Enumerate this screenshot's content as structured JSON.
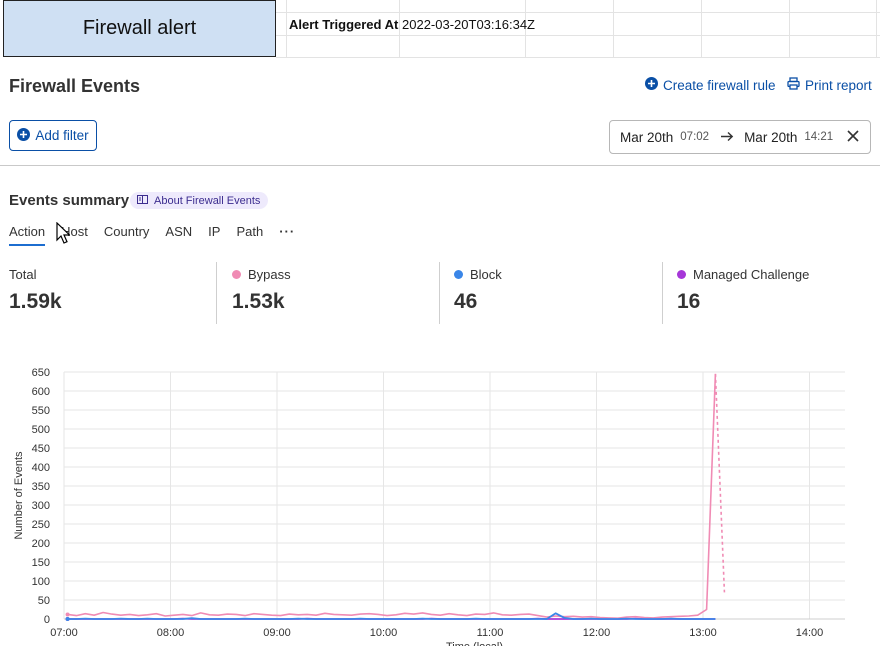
{
  "sheet": {
    "title_cell": "Firewall alert",
    "label_cell": "Alert Triggered At",
    "value_cell": "2022-03-20T03:16:34Z"
  },
  "header": {
    "title": "Firewall Events",
    "create_rule": "Create firewall rule",
    "print_report": "Print report"
  },
  "filters": {
    "add_filter": "Add filter",
    "start_date": "Mar 20th",
    "start_time": "07:02",
    "end_date": "Mar 20th",
    "end_time": "14:21"
  },
  "summary": {
    "title": "Events summary",
    "about_link": "About Firewall Events",
    "tabs": [
      "Action",
      "Host",
      "Country",
      "ASN",
      "IP",
      "Path"
    ],
    "more": "···",
    "stats": [
      {
        "label": "Total",
        "value": "1.59k",
        "color": ""
      },
      {
        "label": "Bypass",
        "value": "1.53k",
        "color": "#f08bb4"
      },
      {
        "label": "Block",
        "value": "46",
        "color": "#3a86e8"
      },
      {
        "label": "Managed Challenge",
        "value": "16",
        "color": "#a637d8"
      }
    ]
  },
  "colors": {
    "accent": "#0a4fa6",
    "bypass": "#f08bb4",
    "block": "#3a86e8",
    "managed_challenge": "#a637d8"
  },
  "chart_data": {
    "type": "line",
    "ylabel": "Number of Events",
    "xlabel": "Time (local)",
    "ylim": [
      0,
      650
    ],
    "yticks": [
      0,
      50,
      100,
      150,
      200,
      250,
      300,
      350,
      400,
      450,
      500,
      550,
      600,
      650
    ],
    "xticks": [
      "07:00",
      "08:00",
      "09:00",
      "10:00",
      "11:00",
      "12:00",
      "13:00",
      "14:00"
    ],
    "grid": true,
    "x_start": "07:02",
    "x_step_minutes": 5,
    "series": [
      {
        "name": "Bypass",
        "color": "#f08bb4",
        "values": [
          12,
          9,
          14,
          10,
          17,
          13,
          10,
          12,
          9,
          11,
          14,
          8,
          10,
          12,
          9,
          16,
          11,
          10,
          13,
          12,
          9,
          14,
          12,
          10,
          9,
          13,
          11,
          12,
          10,
          15,
          12,
          11,
          10,
          13,
          14,
          12,
          9,
          11,
          15,
          13,
          16,
          12,
          10,
          14,
          11,
          9,
          13,
          12,
          16,
          11,
          10,
          12,
          13,
          9,
          5,
          8,
          6,
          7,
          5,
          6,
          4,
          3,
          2,
          5,
          6,
          4,
          3,
          5,
          6,
          7,
          8,
          10,
          25,
          645
        ],
        "projected": [
          645,
          70
        ]
      },
      {
        "name": "Block",
        "color": "#3a86e8",
        "values": [
          0,
          0,
          1,
          0,
          0,
          0,
          1,
          0,
          0,
          1,
          0,
          0,
          0,
          0,
          2,
          0,
          0,
          0,
          0,
          0,
          1,
          0,
          0,
          0,
          0,
          0,
          1,
          0,
          0,
          0,
          0,
          0,
          0,
          1,
          0,
          0,
          0,
          0,
          0,
          0,
          1,
          0,
          0,
          0,
          0,
          0,
          1,
          0,
          0,
          0,
          0,
          0,
          0,
          0,
          0,
          15,
          3,
          0,
          0,
          1,
          0,
          0,
          0,
          1,
          0,
          0,
          0,
          0,
          1,
          0,
          0,
          0,
          0,
          0
        ],
        "projected": []
      },
      {
        "name": "Managed Challenge",
        "color": "#a637d8",
        "values": [
          0,
          0,
          0,
          0,
          0,
          0,
          0,
          0,
          0,
          0,
          0,
          0,
          0,
          1,
          0,
          0,
          0,
          0,
          0,
          0,
          0,
          0,
          0,
          0,
          0,
          0,
          0,
          1,
          0,
          0,
          0,
          0,
          0,
          0,
          0,
          0,
          0,
          0,
          0,
          0,
          0,
          1,
          0,
          0,
          0,
          0,
          0,
          0,
          0,
          0,
          0,
          0,
          0,
          1,
          0,
          0,
          0,
          0,
          0,
          0,
          0,
          0,
          0,
          0,
          1,
          0,
          0,
          0,
          0,
          0,
          0,
          0,
          0,
          0
        ],
        "projected": []
      }
    ]
  }
}
